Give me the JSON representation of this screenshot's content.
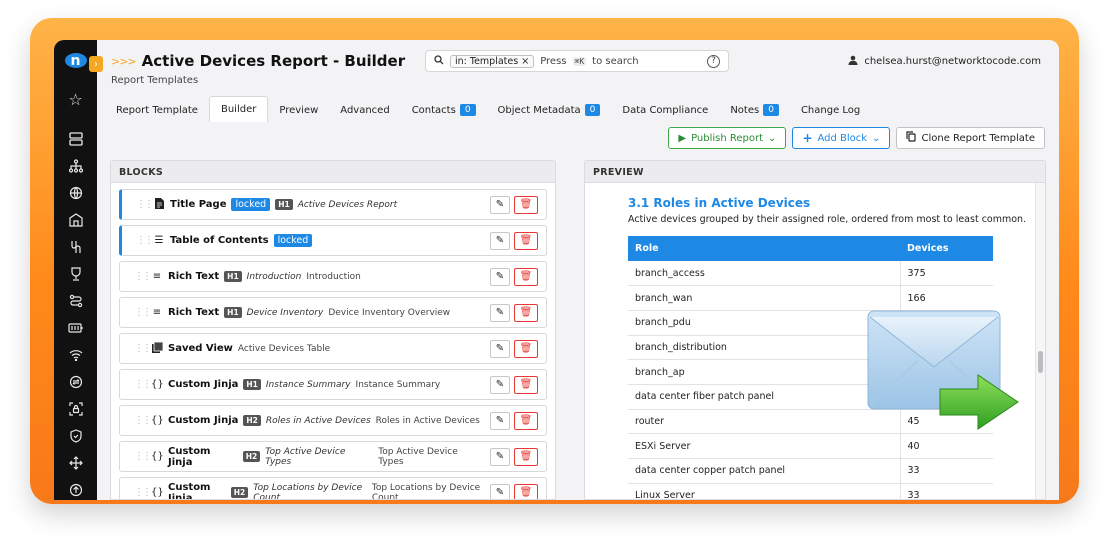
{
  "app": {
    "title": "Active Devices Report - Builder",
    "breadcrumb": "Report Templates",
    "logo_glyph": "n",
    "toggle_glyph": "›",
    "title_chevrons": ">>>"
  },
  "search": {
    "filter_chip": "in: Templates",
    "chip_close": "×",
    "hint_prefix": "Press",
    "hint_key": "⌘K",
    "hint_suffix": "to search",
    "help_glyph": "?"
  },
  "user": {
    "email": "chelsea.hurst@networktocode.com",
    "icon": "person-icon"
  },
  "tabs": [
    {
      "label": "Report Template",
      "active": false
    },
    {
      "label": "Builder",
      "active": true
    },
    {
      "label": "Preview",
      "active": false
    },
    {
      "label": "Advanced",
      "active": false
    },
    {
      "label": "Contacts",
      "badge": "0"
    },
    {
      "label": "Object Metadata",
      "badge": "0"
    },
    {
      "label": "Data Compliance"
    },
    {
      "label": "Notes",
      "badge": "0"
    },
    {
      "label": "Change Log"
    }
  ],
  "actions": {
    "publish": "Publish Report",
    "add_block": "Add Block",
    "clone": "Clone Report Template"
  },
  "blocks_panel": {
    "heading": "BLOCKS",
    "items": [
      {
        "type": "Title Page",
        "locked": "locked",
        "heading": "H1",
        "title": "Active Devices Report",
        "desc": ""
      },
      {
        "type": "Table of Contents",
        "locked": "locked",
        "heading": "",
        "title": "",
        "desc": ""
      },
      {
        "type": "Rich Text",
        "heading": "H1",
        "title": "Introduction",
        "desc": "Introduction"
      },
      {
        "type": "Rich Text",
        "heading": "H1",
        "title": "Device Inventory",
        "desc": "Device Inventory Overview"
      },
      {
        "type": "Saved View",
        "heading": "",
        "title": "",
        "desc": "Active Devices Table"
      },
      {
        "type": "Custom Jinja",
        "heading": "H1",
        "title": "Instance Summary",
        "desc": "Instance Summary"
      },
      {
        "type": "Custom Jinja",
        "heading": "H2",
        "title": "Roles in Active Devices",
        "desc": "Roles in Active Devices"
      },
      {
        "type": "Custom Jinja",
        "heading": "H2",
        "title": "Top Active Device Types",
        "desc": "Top Active Device Types"
      },
      {
        "type": "Custom Jinja",
        "heading": "H2",
        "title": "Top Locations by Device Count",
        "desc": "Top Locations by Device Count"
      }
    ]
  },
  "preview_panel": {
    "heading": "PREVIEW",
    "section_title": "3.1 Roles in Active Devices",
    "section_desc": "Active devices grouped by their assigned role, ordered from most to least common.",
    "columns": [
      "Role",
      "Devices"
    ],
    "rows": [
      [
        "branch_access",
        "375"
      ],
      [
        "branch_wan",
        "166"
      ],
      [
        "branch_pdu",
        ""
      ],
      [
        "branch_distribution",
        ""
      ],
      [
        "branch_ap",
        ""
      ],
      [
        "data center fiber patch panel",
        ""
      ],
      [
        "router",
        "45"
      ],
      [
        "ESXi Server",
        "40"
      ],
      [
        "data center copper patch panel",
        "33"
      ],
      [
        "Linux Server",
        "33"
      ]
    ]
  },
  "icons": {
    "sidebar": [
      "star-icon",
      "server-icon",
      "network-icon",
      "globe-icon",
      "building-icon",
      "circuits-icon",
      "trophy-icon",
      "routing-icon",
      "battery-icon",
      "wifi-icon",
      "vpn-icon",
      "lock-screen-icon",
      "shield-icon",
      "move-icon",
      "upload-icon"
    ]
  },
  "colors": {
    "accent": "#1e88e5",
    "brand_orange": "#f7791a",
    "danger": "#e53935",
    "success": "#3fa84a"
  }
}
